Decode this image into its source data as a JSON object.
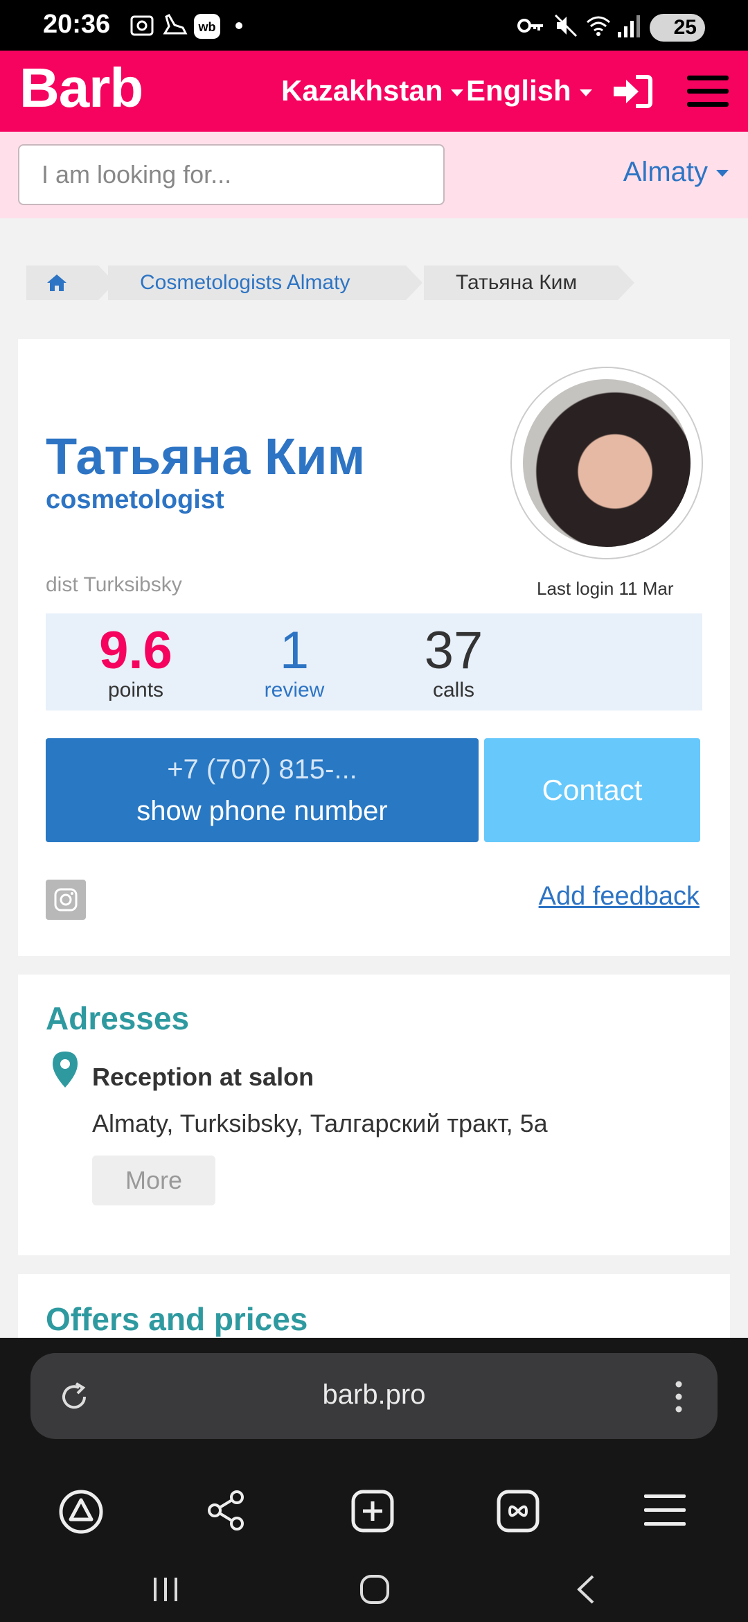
{
  "status_bar": {
    "time": "20:36",
    "battery": "25"
  },
  "header": {
    "logo": "Barb",
    "country": "Kazakhstan",
    "language": "English"
  },
  "search": {
    "placeholder": "I am looking for...",
    "city": "Almaty"
  },
  "breadcrumb": {
    "category": "Cosmetologists Almaty",
    "current": "Татьяна Ким"
  },
  "profile": {
    "name": "Татьяна Ким",
    "profession": "cosmetologist",
    "district": "dist Turksibsky",
    "last_login": "Last login 11 Mar",
    "stats": {
      "points_value": "9.6",
      "points_label": "points",
      "reviews_value": "1",
      "reviews_label": "review",
      "calls_value": "37",
      "calls_label": "calls"
    },
    "phone_masked": "+7 (707) 815-...",
    "phone_action": "show phone number",
    "contact_label": "Contact",
    "feedback_label": "Add feedback"
  },
  "addresses": {
    "title": "Adresses",
    "type": "Reception at salon",
    "address": "Almaty, Turksibsky, Талгарский тракт, 5а",
    "more_label": "More"
  },
  "offers": {
    "title": "Offers and prices"
  },
  "browser": {
    "url": "barb.pro"
  },
  "colors": {
    "brand": "#f5035e",
    "link": "#2d74c4",
    "section": "#2e9aa0",
    "contact": "#66c8fb",
    "phone_button": "#2878c3"
  }
}
